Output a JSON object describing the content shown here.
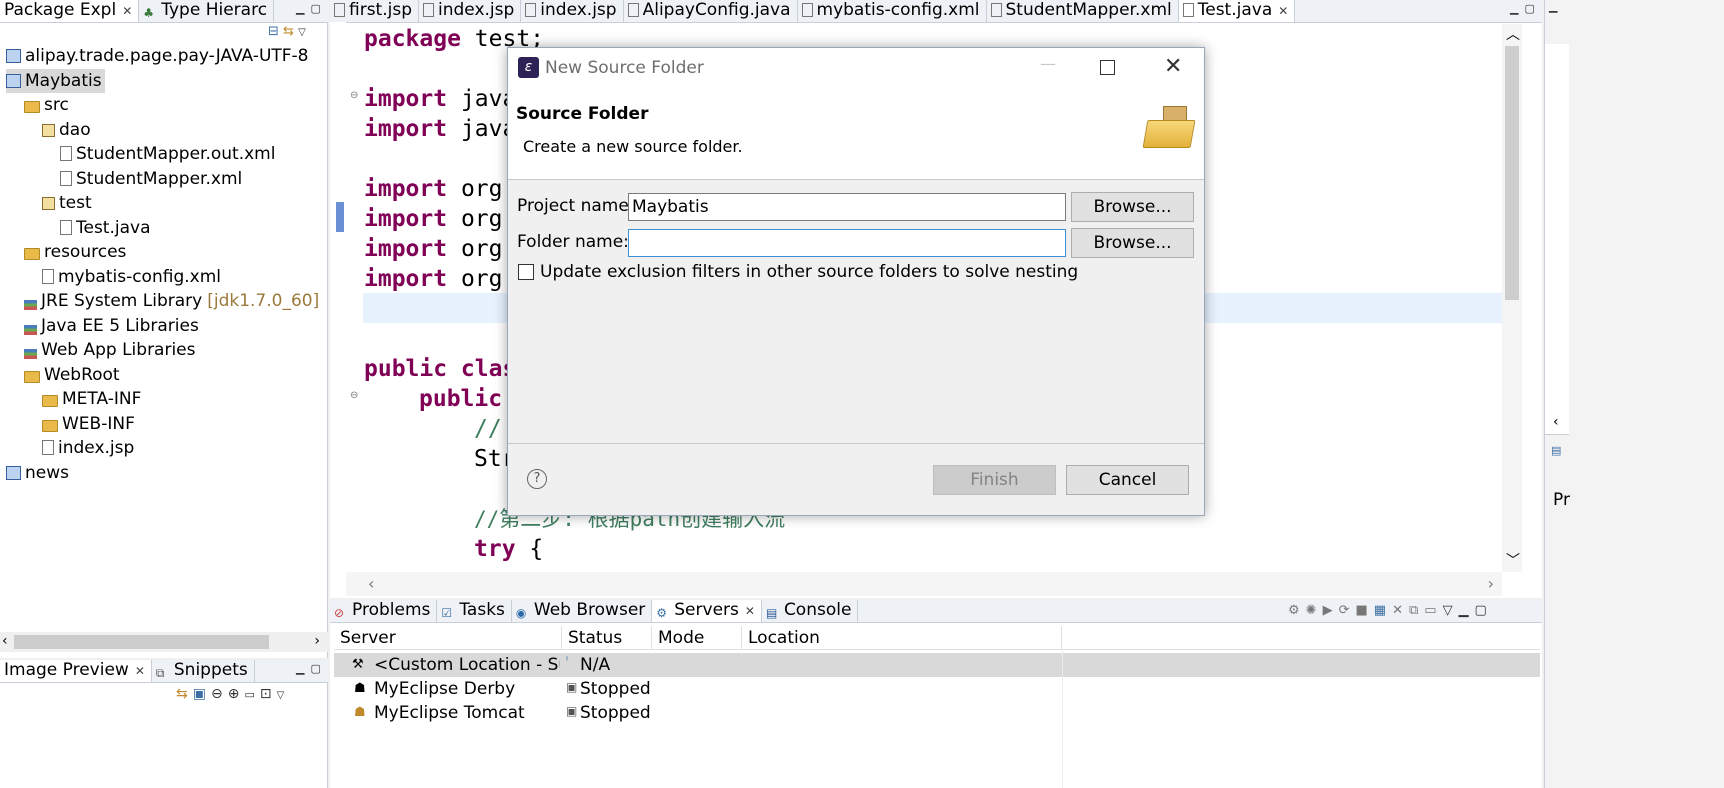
{
  "left_panel": {
    "tabs": [
      {
        "label": "Package Expl",
        "active": true
      },
      {
        "label": "Type Hierarc",
        "active": false
      }
    ],
    "tree": [
      {
        "label": "alipay.trade.page.pay-JAVA-UTF-8",
        "icon": "project-icon",
        "indent": 0
      },
      {
        "label": "Maybatis",
        "icon": "project-icon",
        "indent": 0,
        "selected": true
      },
      {
        "label": "src",
        "icon": "source-folder-icon",
        "indent": 1
      },
      {
        "label": "dao",
        "icon": "package-icon",
        "indent": 2
      },
      {
        "label": "StudentMapper.out.xml",
        "icon": "xml-file-icon",
        "indent": 3
      },
      {
        "label": "StudentMapper.xml",
        "icon": "xml-file-icon",
        "indent": 3
      },
      {
        "label": "test",
        "icon": "package-icon",
        "indent": 2
      },
      {
        "label": "Test.java",
        "icon": "java-file-icon",
        "indent": 3
      },
      {
        "label": "resources",
        "icon": "source-folder-icon",
        "indent": 1
      },
      {
        "label": "mybatis-config.xml",
        "icon": "xml-file-icon",
        "indent": 2
      },
      {
        "label": "JRE System Library",
        "suffix": "[jdk1.7.0_60]",
        "icon": "library-icon",
        "indent": 1
      },
      {
        "label": "Java EE 5 Libraries",
        "icon": "library-icon",
        "indent": 1
      },
      {
        "label": "Web App Libraries",
        "icon": "library-icon",
        "indent": 1
      },
      {
        "label": "WebRoot",
        "icon": "folder-icon",
        "indent": 1
      },
      {
        "label": "META-INF",
        "icon": "folder-icon",
        "indent": 2
      },
      {
        "label": "WEB-INF",
        "icon": "folder-icon",
        "indent": 2
      },
      {
        "label": "index.jsp",
        "icon": "jsp-file-icon",
        "indent": 2
      },
      {
        "label": "news",
        "icon": "project-icon",
        "indent": 0
      }
    ],
    "bottom_tabs": [
      {
        "label": "Image Preview",
        "active": true
      },
      {
        "label": "Snippets",
        "active": false
      }
    ]
  },
  "editor": {
    "tabs": [
      {
        "label": "first.jsp",
        "active": false
      },
      {
        "label": "index.jsp",
        "active": false
      },
      {
        "label": "index.jsp",
        "active": false
      },
      {
        "label": "AlipayConfig.java",
        "active": false
      },
      {
        "label": "mybatis-config.xml",
        "active": false
      },
      {
        "label": "StudentMapper.xml",
        "active": false
      },
      {
        "label": "Test.java",
        "active": true
      }
    ],
    "lines": {
      "l1_kw": "package",
      "l1_rest": " test;",
      "l2_kw": "import",
      "l2_rest": " java",
      "l3_kw": "import",
      "l3_rest": " java",
      "l4_kw": "import",
      "l4_rest": " org.",
      "l5_kw": "import",
      "l5_rest": " org.",
      "l6_kw": "import",
      "l6_rest": " org.",
      "l7_kw": "import",
      "l7_rest": " org.",
      "l8_kw": "public clas",
      "l9_kw": "public",
      "l10_cm": "//",
      "l11_rest": "Str",
      "l12_cm": "//第二步: 根据path创建输入流",
      "l13_kw": "try",
      "l13_rest": " {"
    }
  },
  "bottom_panel": {
    "tabs": [
      {
        "label": "Problems",
        "active": false
      },
      {
        "label": "Tasks",
        "active": false
      },
      {
        "label": "Web Browser",
        "active": false
      },
      {
        "label": "Servers",
        "active": true
      },
      {
        "label": "Console",
        "active": false
      }
    ],
    "columns": [
      "Server",
      "Status",
      "Mode",
      "Location"
    ],
    "rows": [
      {
        "server": "<Custom Location - Sufl",
        "status": "N/A",
        "mode": "",
        "location": "",
        "selected": true
      },
      {
        "server": "MyEclipse Derby",
        "status": "Stopped",
        "mode": "",
        "location": ""
      },
      {
        "server": "MyEclipse Tomcat",
        "status": "Stopped",
        "mode": "",
        "location": ""
      }
    ]
  },
  "right_strip": {
    "label": "Pr"
  },
  "dialog": {
    "title": "New Source Folder",
    "heading": "Source Folder",
    "description": "Create a new source folder.",
    "project_label": "Project name:",
    "project_value": "Maybatis",
    "folder_label": "Folder name:",
    "folder_value": "",
    "browse1": "Browse...",
    "browse2": "Browse...",
    "checkbox_label": "Update exclusion filters in other source folders to solve nesting",
    "checkbox_checked": false,
    "help": "?",
    "finish": "Finish",
    "cancel": "Cancel"
  }
}
